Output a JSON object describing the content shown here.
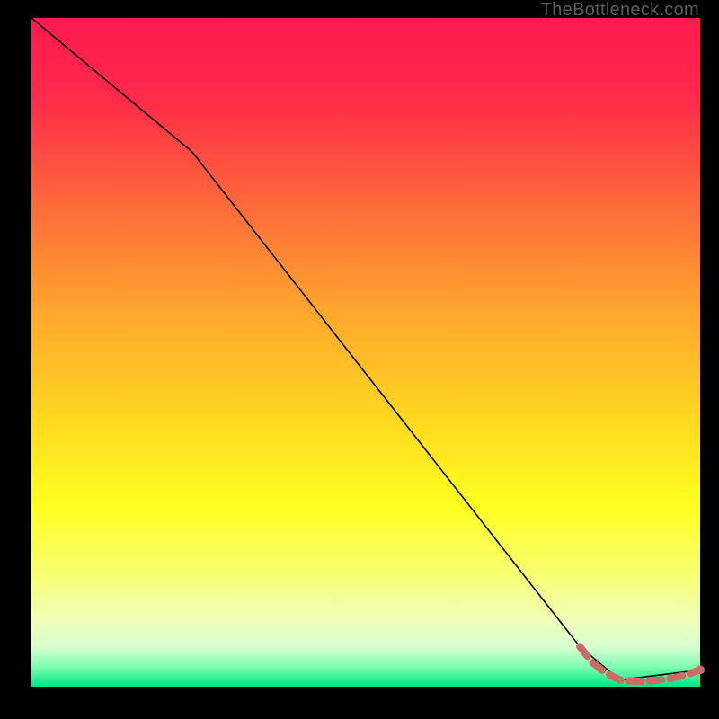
{
  "watermark": "TheBottleneck.com",
  "gradient": {
    "stops": [
      {
        "pct": 0,
        "color": "#ff1a50"
      },
      {
        "pct": 12,
        "color": "#ff2a4a"
      },
      {
        "pct": 28,
        "color": "#ff6a3a"
      },
      {
        "pct": 45,
        "color": "#ffaa2c"
      },
      {
        "pct": 60,
        "color": "#ffd820"
      },
      {
        "pct": 73,
        "color": "#ffff20"
      },
      {
        "pct": 83,
        "color": "#f8ff70"
      },
      {
        "pct": 90,
        "color": "#f0ffb8"
      },
      {
        "pct": 94,
        "color": "#d8ffd0"
      },
      {
        "pct": 97,
        "color": "#7fffb0"
      },
      {
        "pct": 100,
        "color": "#00e584"
      }
    ]
  },
  "chart_data": {
    "type": "line",
    "title": "",
    "xlabel": "",
    "ylabel": "",
    "xlim": [
      0,
      100
    ],
    "ylim": [
      0,
      100
    ],
    "series": [
      {
        "name": "bottleneck-curve",
        "style": "solid",
        "color": "#000000",
        "points": [
          {
            "x": 0,
            "y": 100
          },
          {
            "x": 24,
            "y": 80
          },
          {
            "x": 82,
            "y": 6
          },
          {
            "x": 88,
            "y": 1
          },
          {
            "x": 100,
            "y": 2.5
          }
        ]
      },
      {
        "name": "optimal-range",
        "style": "dashed-markers",
        "color": "#cc6a66",
        "points": [
          {
            "x": 82,
            "y": 6
          },
          {
            "x": 84,
            "y": 3.5
          },
          {
            "x": 86,
            "y": 2
          },
          {
            "x": 88,
            "y": 1
          },
          {
            "x": 90,
            "y": 0.8
          },
          {
            "x": 92,
            "y": 0.8
          },
          {
            "x": 94,
            "y": 1
          },
          {
            "x": 96,
            "y": 1.3
          },
          {
            "x": 98,
            "y": 1.8
          },
          {
            "x": 100,
            "y": 2.5
          }
        ]
      }
    ]
  }
}
